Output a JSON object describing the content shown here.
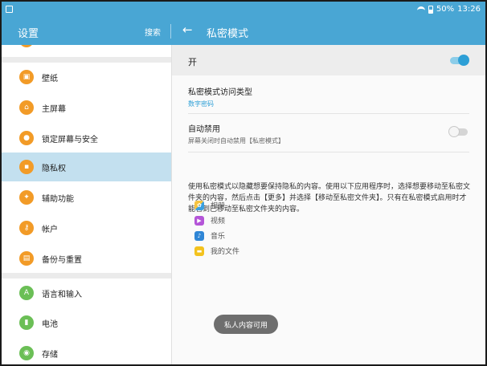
{
  "status_bar": {
    "battery": "50%",
    "time": "13:26"
  },
  "action_bar": {
    "left_title": "设置",
    "search_label": "搜索",
    "right_title": "私密模式"
  },
  "sidebar": {
    "partial_item": "…",
    "items": [
      {
        "label": "壁纸",
        "icon": "wallpaper-icon",
        "color": "#f29b27"
      },
      {
        "label": "主屏幕",
        "icon": "home-icon",
        "color": "#f29b27"
      },
      {
        "label": "锁定屏幕与安全",
        "icon": "lock-icon",
        "color": "#f29b27"
      },
      {
        "label": "隐私权",
        "icon": "privacy-icon",
        "color": "#f29b27",
        "selected": true
      },
      {
        "label": "辅助功能",
        "icon": "accessibility-icon",
        "color": "#f29b27"
      },
      {
        "label": "帐户",
        "icon": "key-icon",
        "color": "#f29b27"
      },
      {
        "label": "备份与重置",
        "icon": "backup-icon",
        "color": "#f29b27"
      },
      {
        "label": "语言和输入",
        "icon": "language-icon",
        "color": "#6bbf56"
      },
      {
        "label": "电池",
        "icon": "battery-icon",
        "color": "#6bbf56"
      },
      {
        "label": "存储",
        "icon": "storage-icon",
        "color": "#6bbf56"
      }
    ]
  },
  "private_mode": {
    "master_label": "开",
    "master_on": true,
    "access_type_title": "私密模式访问类型",
    "access_type_value": "数字密码",
    "access_type_color": "#2d9fd6",
    "auto_disable_title": "自动禁用",
    "auto_disable_sub": "屏幕关闭时自动禁用【私密模式】",
    "auto_disable_on": false,
    "description": "使用私密模式以隐藏想要保持隐私的内容。使用以下应用程序时，选择想要移动至私密文件夹的内容，然后点击【更多】并选择【移动至私密文件夹】。只有在私密模式启用时才能看到已移动至私密文件夹的内容。",
    "apps": [
      {
        "label": "相册",
        "icon": "gallery-icon"
      },
      {
        "label": "视频",
        "icon": "video-icon"
      },
      {
        "label": "音乐",
        "icon": "music-icon"
      },
      {
        "label": "我的文件",
        "icon": "my-files-icon"
      }
    ]
  },
  "toast": {
    "text": "私人内容可用"
  }
}
